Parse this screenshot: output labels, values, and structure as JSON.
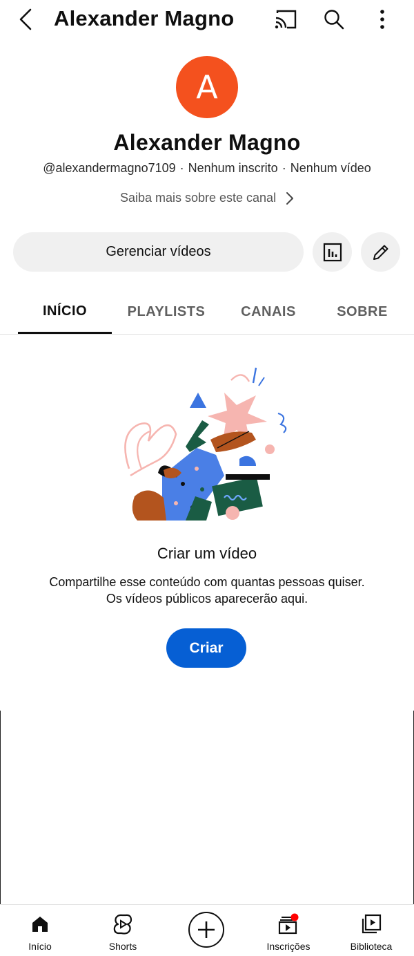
{
  "header": {
    "title": "Alexander Magno",
    "icons": [
      "back-icon",
      "cast-icon",
      "search-icon",
      "more-vert-icon"
    ]
  },
  "channel": {
    "avatar_letter": "A",
    "avatar_color": "#f4511e",
    "name": "Alexander Magno",
    "handle": "@alexandermagno7109",
    "subscribers": "Nenhum inscrito",
    "videos": "Nenhum vídeo",
    "separator": "·",
    "learn_more": "Saiba mais sobre este canal"
  },
  "actions": {
    "manage_videos": "Gerenciar vídeos",
    "analytics_icon": "analytics-icon",
    "edit_icon": "pencil-icon"
  },
  "tabs": [
    {
      "label": "INÍCIO",
      "active": true
    },
    {
      "label": "PLAYLISTS",
      "active": false
    },
    {
      "label": "CANAIS",
      "active": false
    },
    {
      "label": "SOBRE",
      "active": false
    }
  ],
  "empty_state": {
    "title": "Criar um vídeo",
    "line1": "Compartilhe esse conteúdo com quantas pessoas quiser.",
    "line2": "Os vídeos públicos aparecerão aqui.",
    "button": "Criar",
    "button_color": "#065fd4"
  },
  "bottom_nav": [
    {
      "label": "Início",
      "icon": "home-icon"
    },
    {
      "label": "Shorts",
      "icon": "shorts-icon"
    },
    {
      "label": "",
      "icon": "add-icon"
    },
    {
      "label": "Inscrições",
      "icon": "subscriptions-icon",
      "badge_color": "#ff0000"
    },
    {
      "label": "Biblioteca",
      "icon": "library-icon"
    }
  ]
}
